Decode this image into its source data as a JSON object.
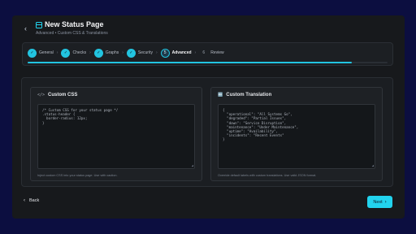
{
  "header": {
    "title": "New Status Page",
    "subtitle": "Advanced • Custom CSS & Translations",
    "back_icon": "chevron-left-icon",
    "title_icon": "window-icon"
  },
  "stepper": {
    "steps": [
      {
        "number": "✓",
        "label": "General",
        "state": "done"
      },
      {
        "number": "✓",
        "label": "Checks",
        "state": "done"
      },
      {
        "number": "✓",
        "label": "Graphs",
        "state": "done"
      },
      {
        "number": "✓",
        "label": "Security",
        "state": "done"
      },
      {
        "number": "5",
        "label": "Advanced",
        "state": "active"
      },
      {
        "number": "6",
        "label": "Review",
        "state": "pending"
      }
    ],
    "separator": "›",
    "progress_fraction": 0.9
  },
  "css_card": {
    "icon": "</>",
    "title": "Custom CSS",
    "code": "/* Custom CSS for your status page */\n.status-header {\n  border-radius: 12px;\n}",
    "hint": "Inject custom CSS into your status page. Use with caution."
  },
  "translation_card": {
    "icon": "🔤",
    "title": "Custom Translation",
    "code": "{\n  \"operational\": \"All Systems Go\",\n  \"degraded\": \"Partial Issues\",\n  \"down\": \"Service Disruption\",\n  \"maintenance\": \"Under Maintenance\",\n  \"uptime\": \"Availability\",\n  \"incidents\": \"Recent Events\"\n}",
    "hint": "Override default labels with custom translations. Use valid JSON format."
  },
  "footer": {
    "back_label": "Back",
    "next_label": "Next"
  },
  "colors": {
    "accent": "#22d3ee",
    "background": "#0c0e40",
    "panel": "#17191c"
  }
}
